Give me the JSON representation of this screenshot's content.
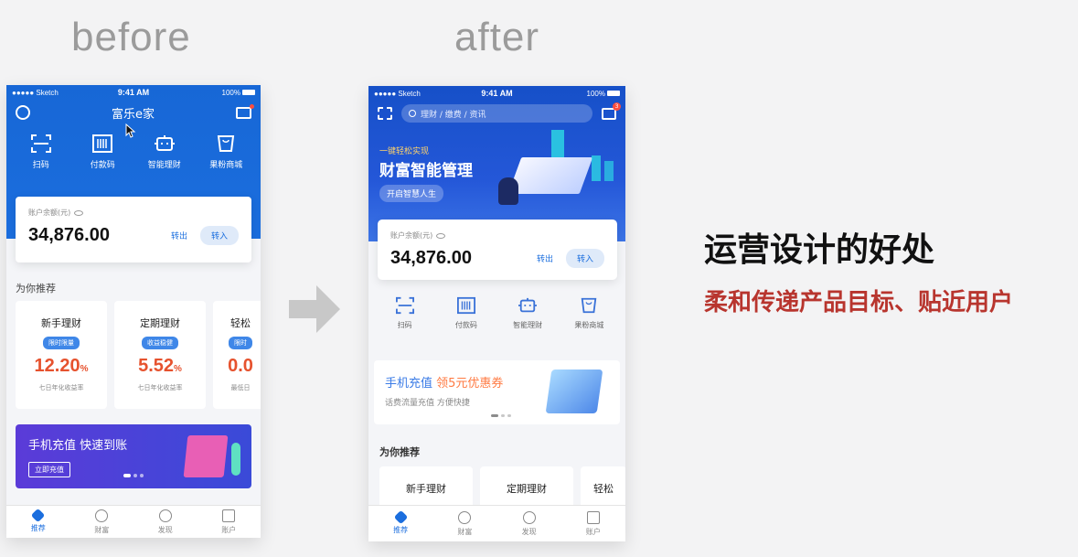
{
  "labels": {
    "before": "before",
    "after": "after"
  },
  "right": {
    "title": "运营设计的好处",
    "subtitle": "柔和传递产品目标、贴近用户"
  },
  "colors": {
    "primary_blue": "#1b6ede",
    "accent_red": "#b8352e",
    "rate_orange": "#e6522e"
  },
  "statusbar": {
    "carrier": "●●●●● Sketch",
    "time": "9:41 AM",
    "battery": "100%"
  },
  "before": {
    "title": "富乐e家",
    "quick_actions": [
      {
        "label": "扫码",
        "icon": "scan-icon"
      },
      {
        "label": "付款码",
        "icon": "barcode-icon"
      },
      {
        "label": "智能理财",
        "icon": "robot-icon"
      },
      {
        "label": "果粉商城",
        "icon": "shop-bag-icon"
      }
    ],
    "account": {
      "label": "账户余额(元)",
      "amount": "34,876.00",
      "transfer_out": "转出",
      "transfer_in": "转入"
    },
    "recommend_title": "为你推荐",
    "products": [
      {
        "name": "新手理财",
        "tag": "限时限量",
        "rate": "12.20",
        "unit": "%",
        "desc": "七日年化收益率"
      },
      {
        "name": "定期理财",
        "tag": "收益稳健",
        "rate": "5.52",
        "unit": "%",
        "desc": "七日年化收益率"
      },
      {
        "name": "轻松",
        "tag": "限时",
        "rate": "0.0",
        "unit": "",
        "desc": "最低日"
      }
    ],
    "banner": {
      "title": "手机充值  快速到账",
      "button": "立即充值"
    },
    "tabs": [
      {
        "label": "推荐",
        "icon": "diamond-icon",
        "active": true
      },
      {
        "label": "财富",
        "icon": "coin-icon",
        "active": false
      },
      {
        "label": "发现",
        "icon": "compass-icon",
        "active": false
      },
      {
        "label": "账户",
        "icon": "wallet-icon",
        "active": false
      }
    ]
  },
  "after": {
    "search_placeholder": "理财 / 缴费 / 资讯",
    "msg_badge": "3",
    "promo": {
      "small": "一键轻松实现",
      "big": "财富智能管理",
      "button": "开启智慧人生"
    },
    "account": {
      "label": "账户余额(元)",
      "amount": "34,876.00",
      "transfer_out": "转出",
      "transfer_in": "转入"
    },
    "quick_actions": [
      {
        "label": "扫码",
        "icon": "scan-icon"
      },
      {
        "label": "付款码",
        "icon": "barcode-icon"
      },
      {
        "label": "智能理财",
        "icon": "robot-icon"
      },
      {
        "label": "果粉商城",
        "icon": "shop-bag-icon"
      }
    ],
    "banner": {
      "title_a": "手机充值 ",
      "title_b": "领5元优惠券",
      "sub": "话费流量充值   方便快捷"
    },
    "recommend_title": "为你推荐",
    "products": [
      {
        "name": "新手理财"
      },
      {
        "name": "定期理财"
      },
      {
        "name": "轻松"
      }
    ],
    "tabs": [
      {
        "label": "推荐",
        "icon": "diamond-icon",
        "active": true
      },
      {
        "label": "财富",
        "icon": "coin-icon",
        "active": false
      },
      {
        "label": "发现",
        "icon": "compass-icon",
        "active": false
      },
      {
        "label": "账户",
        "icon": "wallet-icon",
        "active": false
      }
    ]
  }
}
